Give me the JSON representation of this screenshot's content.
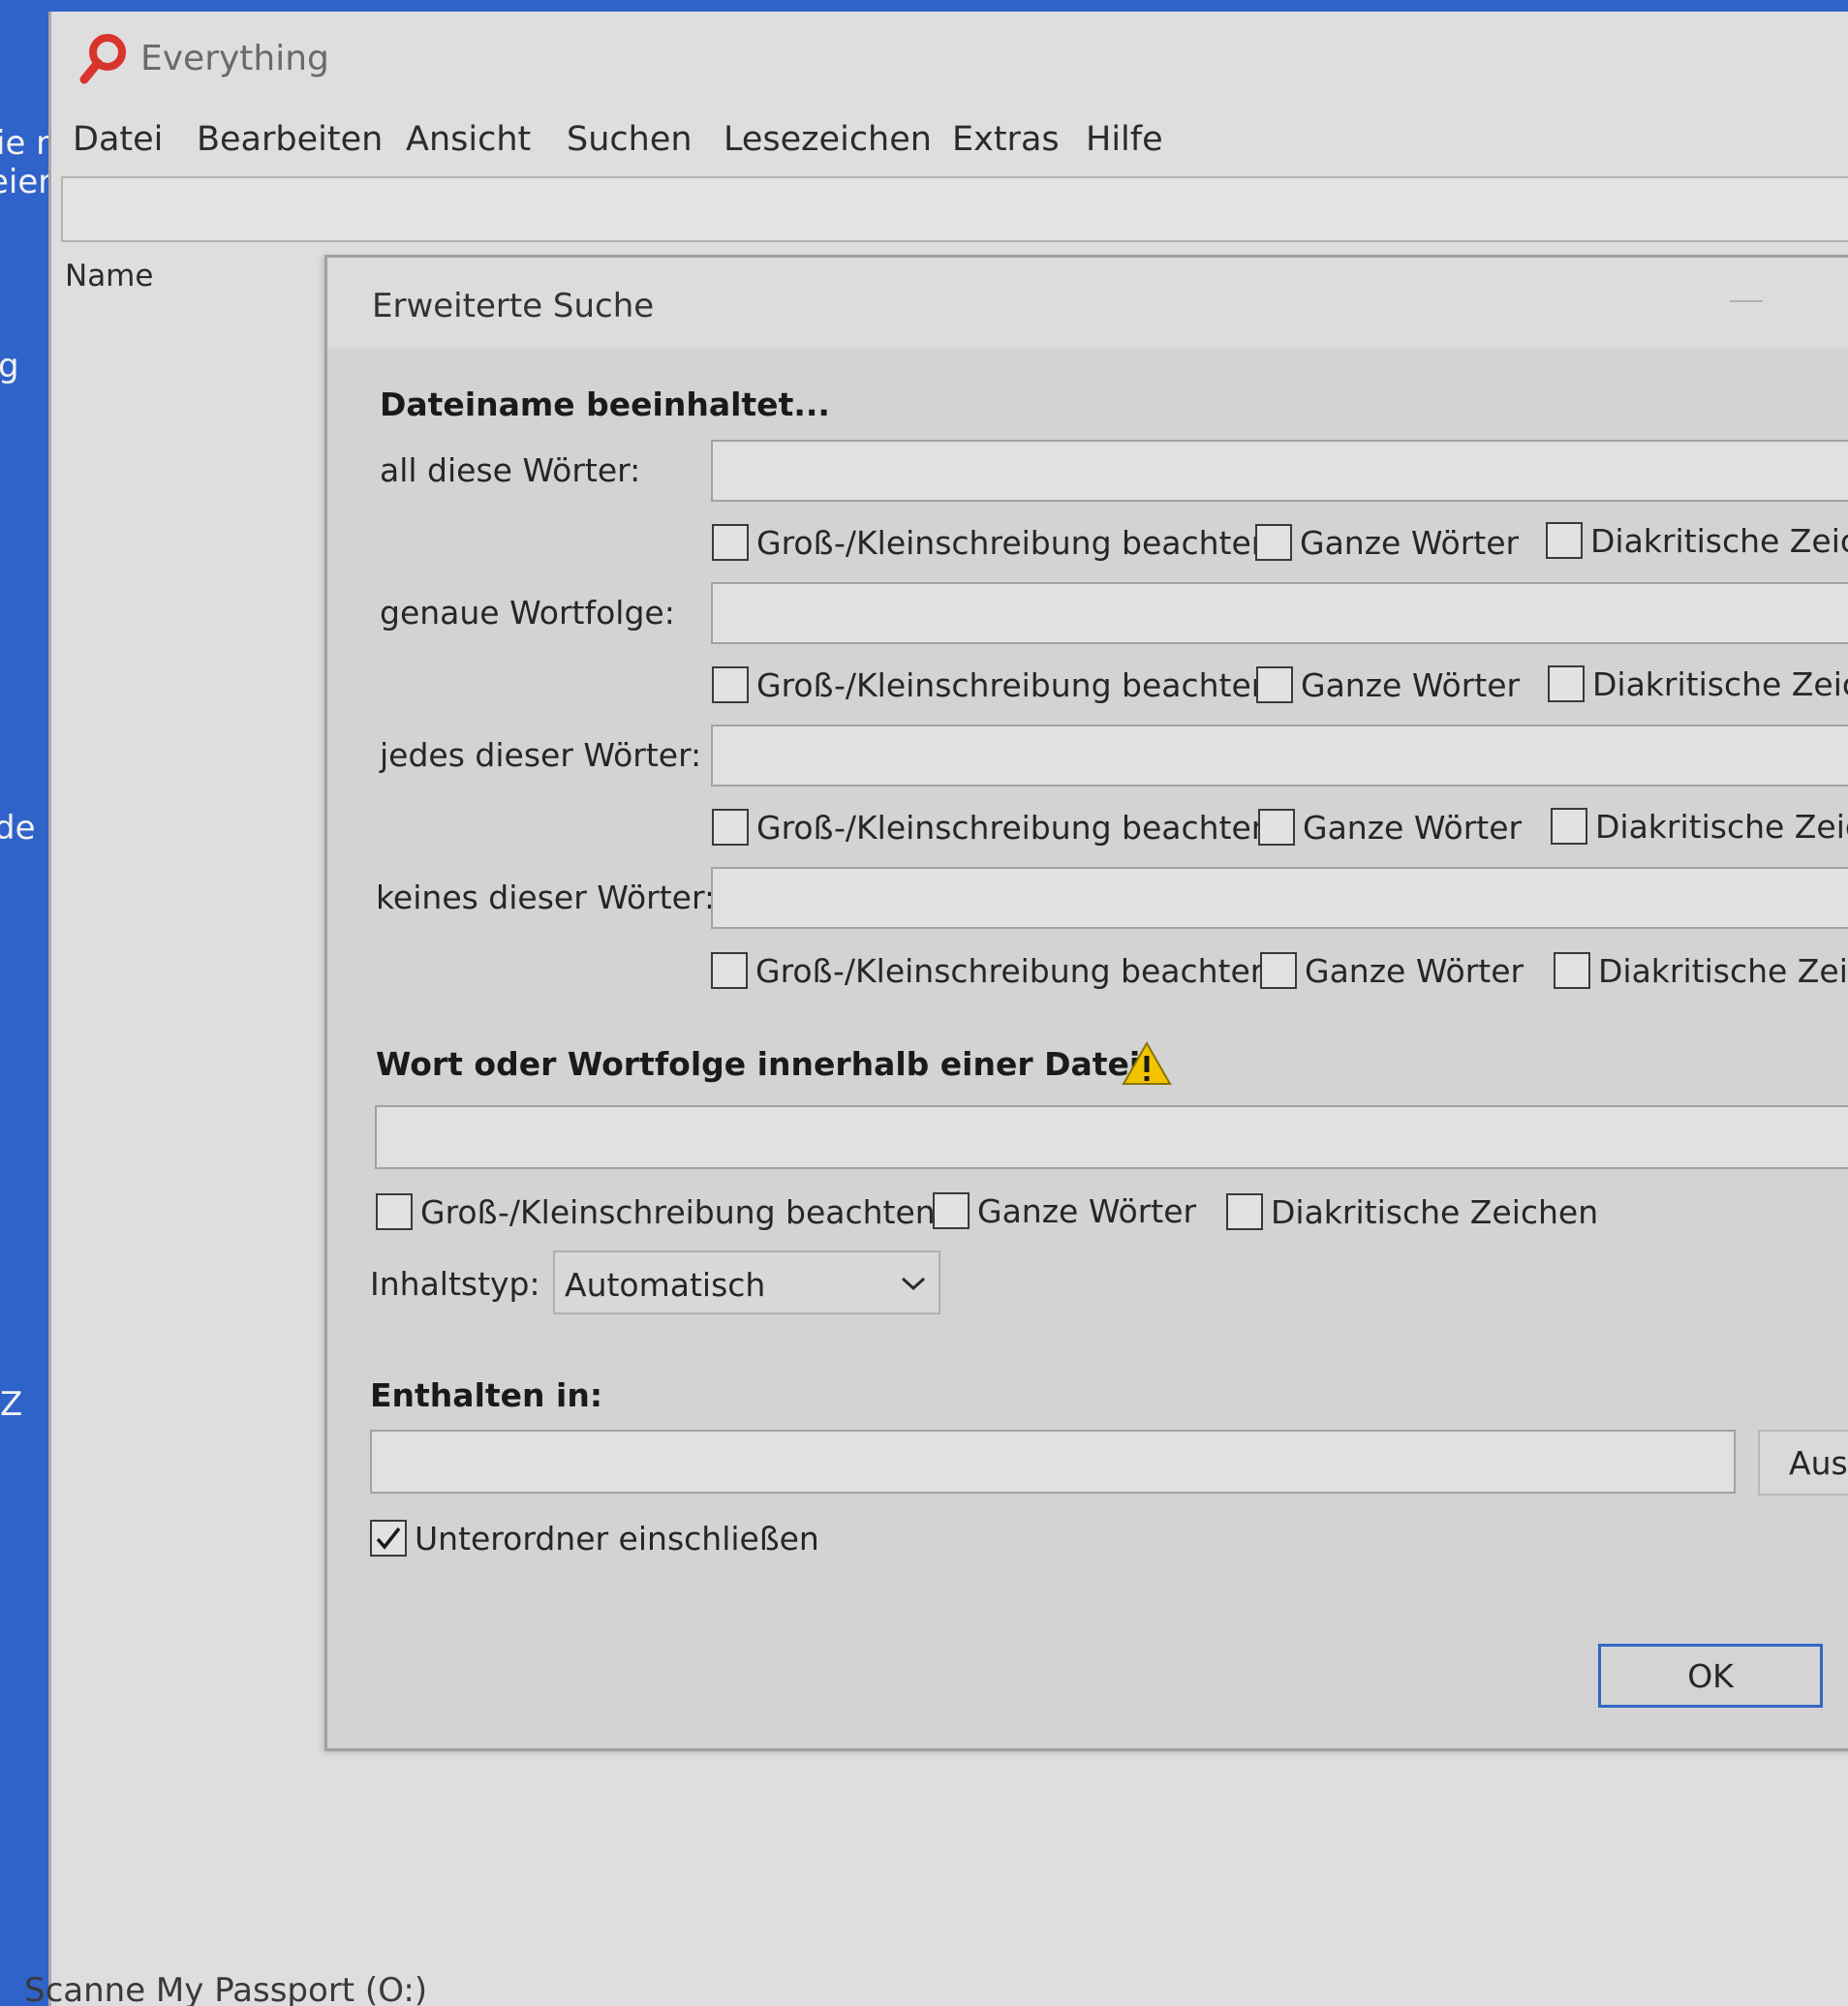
{
  "desktop": {
    "fragments": [
      "ie n",
      "eien",
      "g",
      "de",
      "Z"
    ]
  },
  "window": {
    "title": "Everything",
    "menu": [
      "Datei",
      "Bearbeiten",
      "Ansicht",
      "Suchen",
      "Lesezeichen",
      "Extras",
      "Hilfe"
    ],
    "search_value": "",
    "column_header": "Name",
    "status": "Scanne My Passport (O:)"
  },
  "dialog": {
    "title": "Erweiterte Suche",
    "filename_section": "Dateiname beeinhaltet...",
    "rows": [
      {
        "label": "all diese Wörter:",
        "value": "",
        "case": "Groß-/Kleinschreibung beachten",
        "whole": "Ganze Wörter",
        "diacritics": "Diakritische Zeiche"
      },
      {
        "label": "genaue Wortfolge:",
        "value": "",
        "case": "Groß-/Kleinschreibung beachten",
        "whole": "Ganze Wörter",
        "diacritics": "Diakritische Zeich"
      },
      {
        "label": "jedes dieser Wörter:",
        "value": "",
        "case": "Groß-/Kleinschreibung beachten",
        "whole": "Ganze Wörter",
        "diacritics": "Diakritische Zeich"
      },
      {
        "label": "keines dieser Wörter:",
        "value": "",
        "case": "Groß-/Kleinschreibung beachten",
        "whole": "Ganze Wörter",
        "diacritics": "Diakritische Zeich"
      }
    ],
    "content_section": "Wort oder Wortfolge innerhalb einer Datei:",
    "content_value": "",
    "content_options": {
      "case": "Groß-/Kleinschreibung beachten",
      "whole": "Ganze Wörter",
      "diacritics": "Diakritische Zeichen"
    },
    "content_type_label": "Inhaltstyp:",
    "content_type_value": "Automatisch",
    "location_section": "Enthalten in:",
    "location_value": "",
    "browse_label": "Aus",
    "subfolders_label": "Unterordner einschließen",
    "subfolders_checked": true,
    "ok_label": "OK"
  },
  "colors": {
    "desktop": "#2f63c9",
    "ok_border": "#3465c4",
    "icon_red": "#d9342b",
    "warning_yellow": "#f2c400"
  },
  "icons": [
    "everything-magnifier-icon",
    "warning-icon",
    "chevron-down-icon",
    "checkmark-icon"
  ]
}
